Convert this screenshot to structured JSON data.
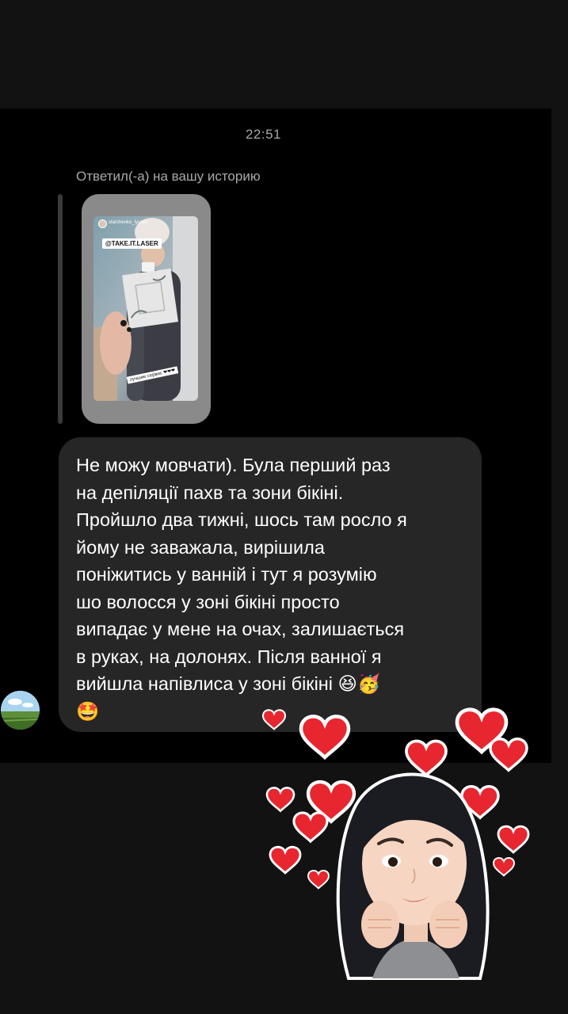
{
  "chat": {
    "timestamp": "22:51",
    "reply_label": "Ответил(-а) на вашу историю",
    "story": {
      "username": "starchenko_lyudm",
      "tag_text": "@TAKE.IT.LASER",
      "sticker_text": "лучшие сервис ❤❤❤"
    },
    "message": {
      "text": "Не можу мовчати). Була перший раз\nна депіляції пахв та зони бікіні.\nПройшло два тижні, шось там росло я\nйому не заважала, вирішила\nпоніжитись у ванній і тут я розумію\nшо волосся у зоні бікіні просто\nвипадає у мене на очах, залишається\nв руках,  на долонях. Після ванної я\nвийшла напівлиса у зоні бікіні 😆🥳\n🤩"
    },
    "sender_avatar": {
      "icon": "landscape-avatar-icon"
    },
    "reaction_sticker": {
      "icon": "girl-with-hearts-sticker",
      "heart_color": "#e8262f"
    }
  },
  "colors": {
    "background": "#121212",
    "chat_background": "#000000",
    "bubble": "#262626",
    "secondary_text": "#a8a8a8"
  }
}
